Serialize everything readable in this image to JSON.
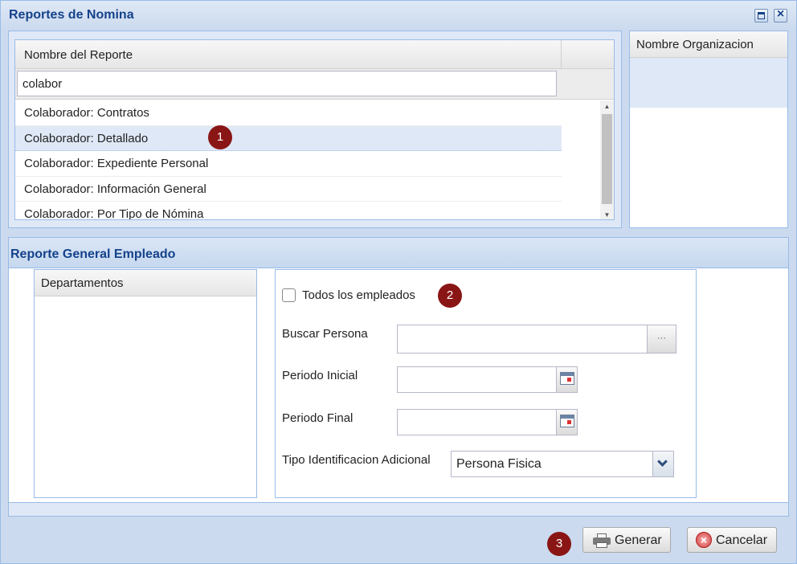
{
  "window": {
    "title": "Reportes de Nomina"
  },
  "report_grid": {
    "header": "Nombre del Reporte",
    "filter_value": "colabor",
    "rows": [
      "Colaborador: Contratos",
      "Colaborador: Detallado",
      "Colaborador: Expediente Personal",
      "Colaborador: Información General",
      "Colaborador: Por Tipo de Nómina"
    ],
    "selected_index": 1
  },
  "org_panel": {
    "header": "Nombre Organizacion"
  },
  "report_panel": {
    "title": "Reporte General Empleado",
    "departments_header": "Departamentos",
    "all_employees_label": "Todos los empleados",
    "all_employees_checked": false,
    "search_person_label": "Buscar Persona",
    "search_person_value": "",
    "period_start_label": "Periodo Inicial",
    "period_start_value": "",
    "period_end_label": "Periodo Final",
    "period_end_value": "",
    "id_type_label": "Tipo Identificacion Adicional",
    "id_type_value": "Persona Fisica"
  },
  "badges": [
    "1",
    "2",
    "3"
  ],
  "buttons": {
    "generar": "Generar",
    "cancelar": "Cancelar"
  },
  "colors": {
    "accent": "#15428b",
    "border": "#99bbe8",
    "badge": "#8a1515",
    "selection": "#dfe8f6"
  },
  "icons": {
    "maximize": "maximize-icon",
    "close": "close-icon",
    "browse": "ellipsis-icon",
    "calendar": "calendar-icon",
    "dropdown": "chevron-down-icon",
    "print": "printer-icon",
    "cancel": "cancel-icon"
  }
}
